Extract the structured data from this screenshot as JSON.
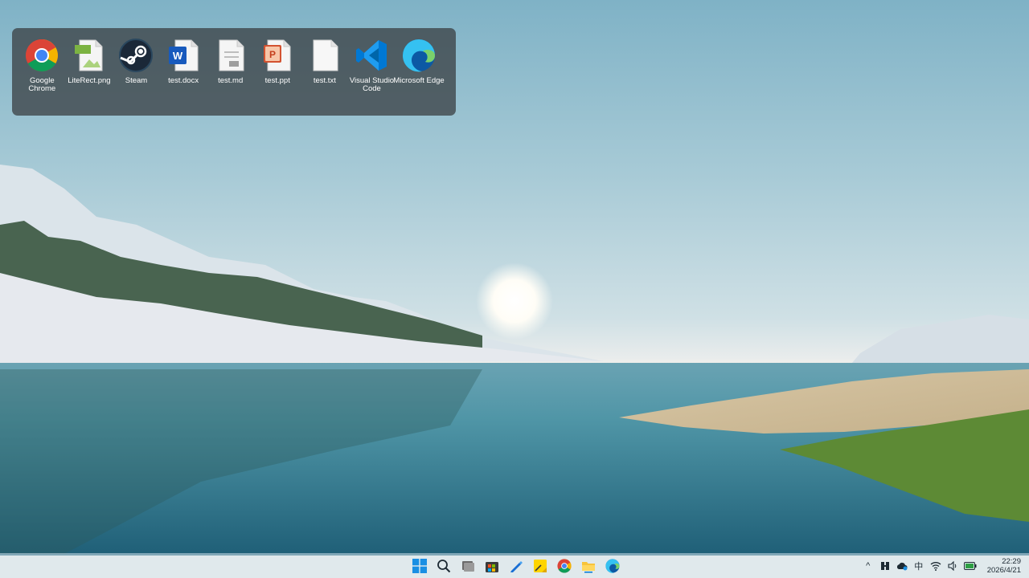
{
  "desktop": {
    "dock_items": [
      {
        "label": "Google Chrome",
        "icon": "chrome-icon"
      },
      {
        "label": "LiteRect.png",
        "icon": "png-file-icon",
        "badge": "PNG"
      },
      {
        "label": "Steam",
        "icon": "steam-icon"
      },
      {
        "label": "test.docx",
        "icon": "word-file-icon",
        "badge": "W"
      },
      {
        "label": "test.md",
        "icon": "markdown-file-icon"
      },
      {
        "label": "test.ppt",
        "icon": "powerpoint-file-icon",
        "badge": "P"
      },
      {
        "label": "test.txt",
        "icon": "text-file-icon"
      },
      {
        "label": "Visual Studio Code",
        "icon": "vscode-icon"
      },
      {
        "label": "Microsoft Edge",
        "icon": "edge-icon"
      }
    ]
  },
  "taskbar": {
    "apps": [
      "start-icon",
      "search-icon",
      "task-view-icon",
      "store-icon",
      "pen-icon",
      "sticky-notes-icon",
      "chrome-icon",
      "file-explorer-icon",
      "edge-icon"
    ],
    "tray": {
      "overflow": "^",
      "ime": "中",
      "time": "22:29",
      "date": "2026/4/21"
    }
  },
  "colors": {
    "dock_bg": "#3c4246",
    "accent": "#0078d4"
  }
}
